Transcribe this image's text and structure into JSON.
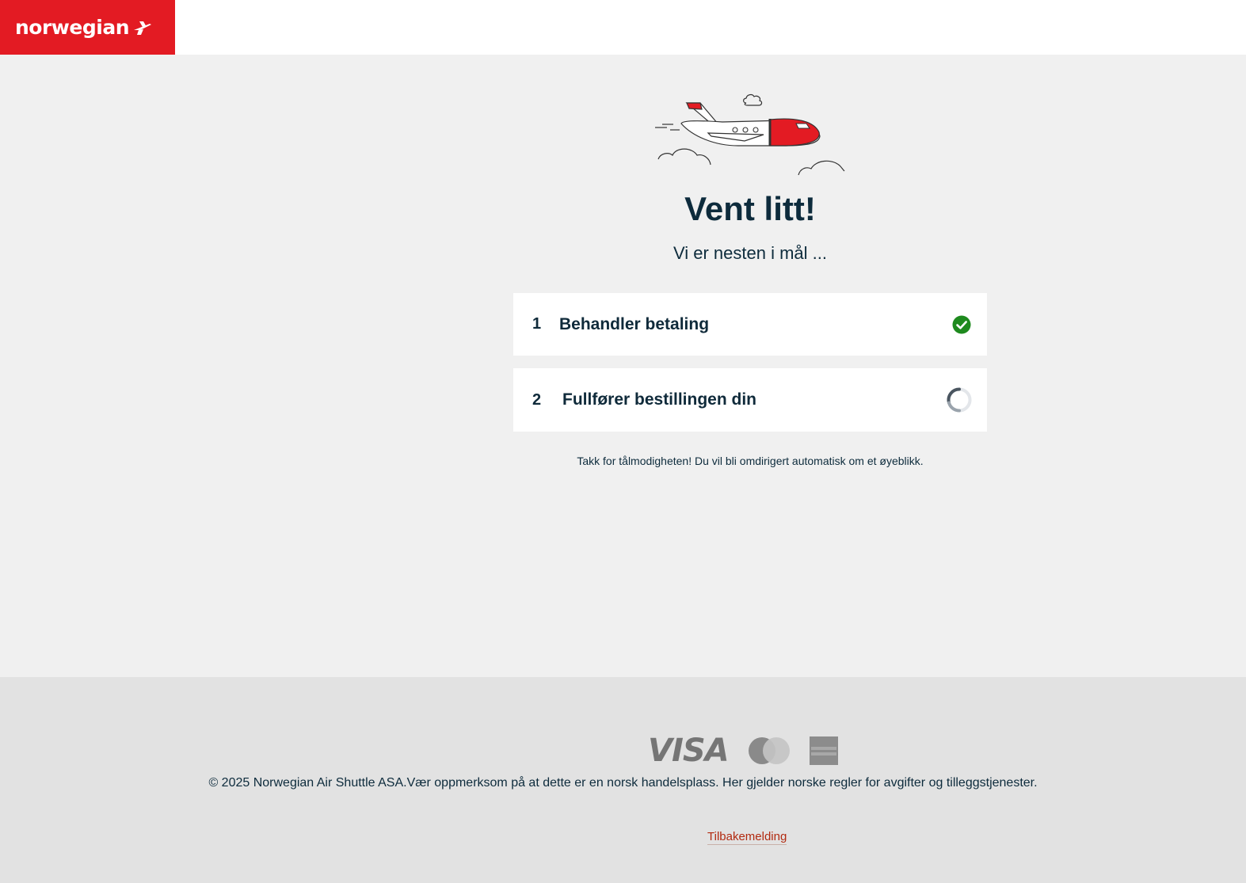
{
  "header": {
    "logo_text": "norwegian"
  },
  "main": {
    "title": "Vent litt!",
    "subtitle": "Vi er nesten i mål ...",
    "steps": [
      {
        "number": "1",
        "label": "Behandler betaling",
        "status": "complete"
      },
      {
        "number": "2",
        "label": "Fullfører bestillingen din",
        "status": "loading"
      }
    ],
    "note": "Takk for tålmodigheten! Du vil bli omdirigert automatisk om et øyeblikk."
  },
  "footer": {
    "cards": [
      "VISA",
      "Mastercard",
      "American Express"
    ],
    "copyright": "© 2025 Norwegian Air Shuttle ASA.Vær oppmerksom på at dette er en norsk handelsplass. Her gjelder norske regler for avgifter og tilleggstjenester.",
    "feedback_link": "Tilbakemelding"
  },
  "colors": {
    "brand_red": "#e31b23",
    "text_navy": "#0d2b3c",
    "success_green": "#1e8a1e",
    "link": "#b22a10"
  }
}
